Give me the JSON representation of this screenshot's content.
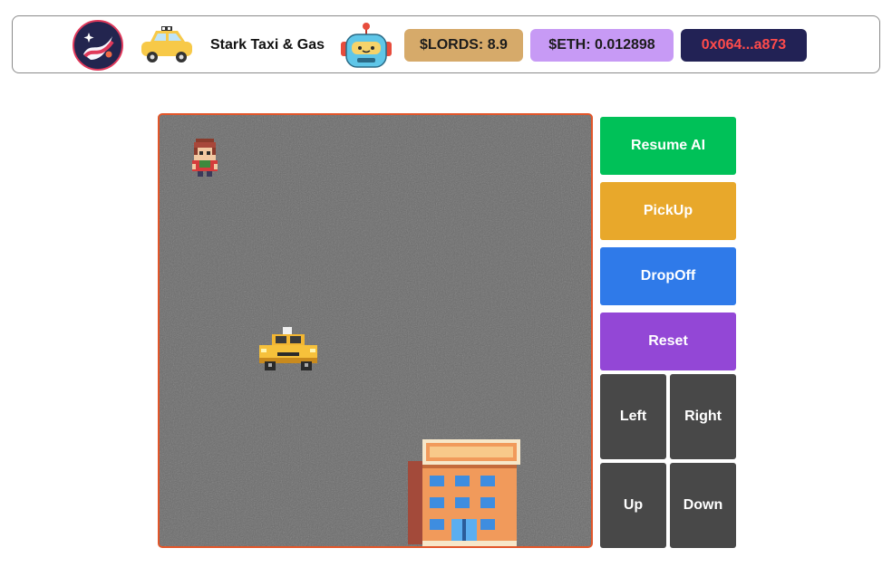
{
  "header": {
    "title": "Stark Taxi & Gas",
    "lords_badge": "$LORDS: 8.9",
    "eth_badge": "$ETH: 0.012898",
    "wallet_address": "0x064...a873",
    "icons": [
      "starknet-logo-icon",
      "taxi-logo-icon",
      "robot-icon"
    ]
  },
  "game": {
    "sprites": [
      "passenger-sprite",
      "taxi-sprite",
      "building-sprite"
    ]
  },
  "controls": {
    "resume_ai": "Resume AI",
    "pickup": "PickUp",
    "dropoff": "DropOff",
    "reset": "Reset",
    "left": "Left",
    "right": "Right",
    "up": "Up",
    "down": "Down"
  },
  "colors": {
    "resume": "#00c158",
    "pickup": "#e8a82b",
    "dropoff": "#2f7ae9",
    "reset": "#9347d6",
    "direction": "#484848",
    "board_border": "#e2562a",
    "lords": "#d6aa6a",
    "eth": "#c79af5",
    "wallet_bg": "#222255",
    "wallet_text": "#ff4b4b"
  }
}
